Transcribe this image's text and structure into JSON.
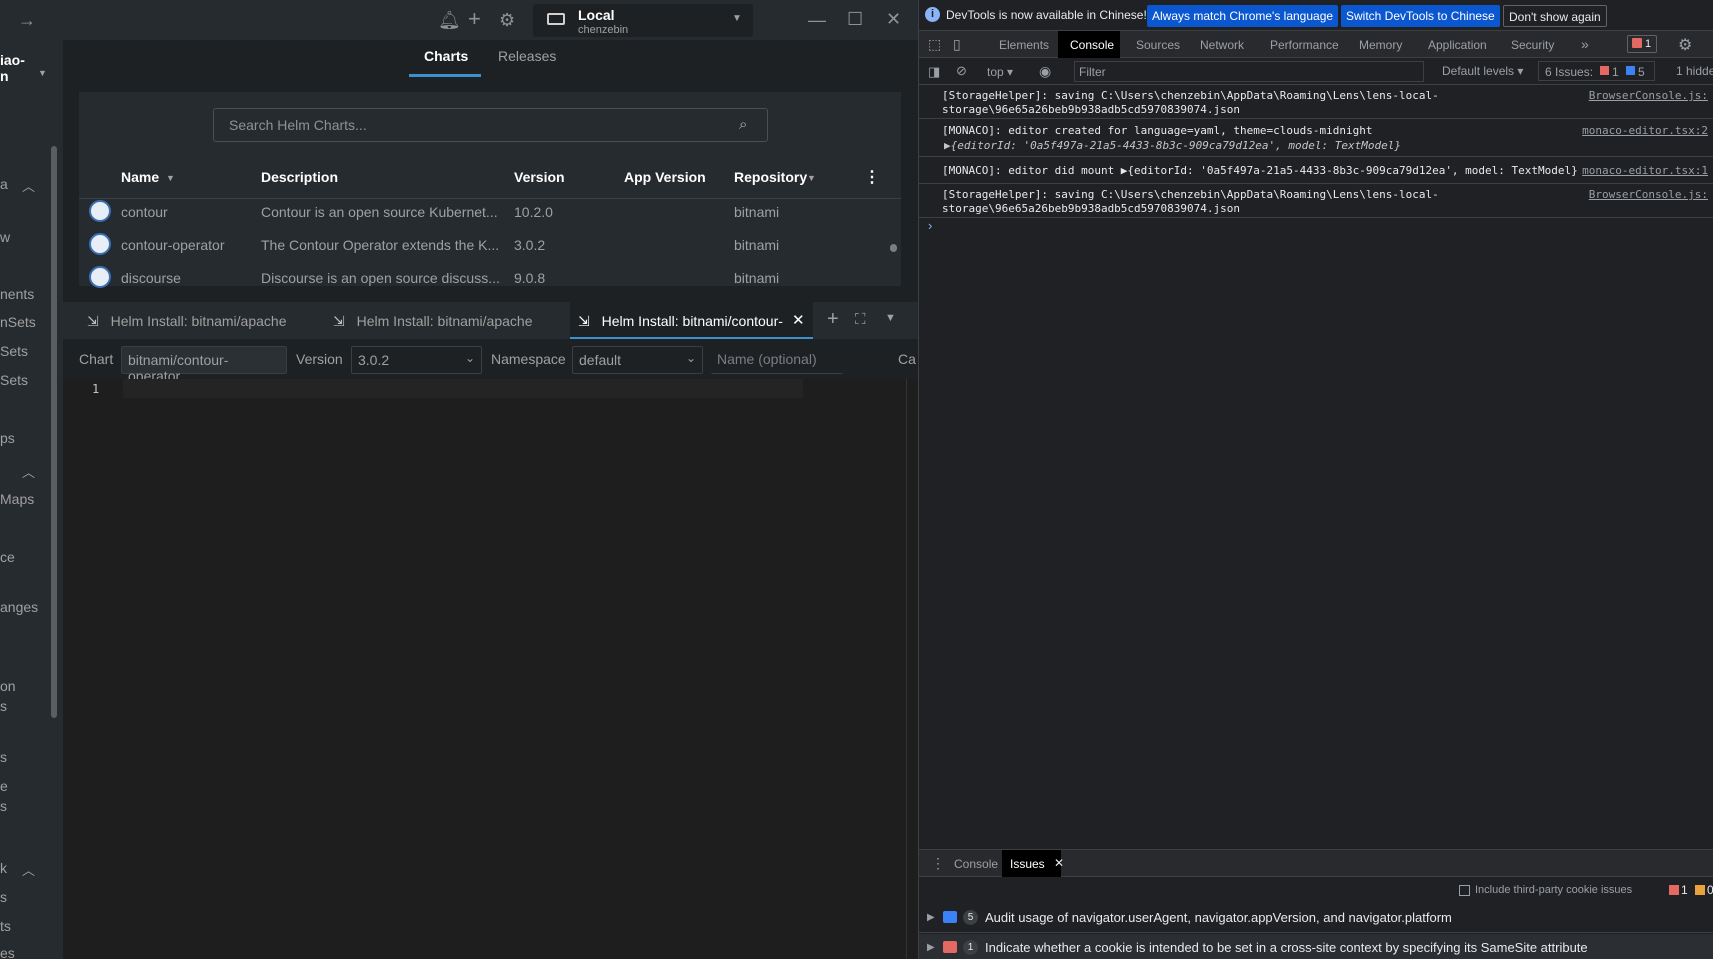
{
  "cluster": {
    "name": "Local",
    "user": "chenzebin"
  },
  "sidebar": {
    "top_label": "iao-\nn",
    "items": [
      "w",
      "nents",
      "nSets",
      "Sets",
      "Sets",
      "ps",
      "Maps",
      "ce",
      "anges",
      "on",
      "s",
      "s",
      "e",
      "s",
      "k",
      "s",
      "ts",
      "es"
    ]
  },
  "tabs": {
    "charts": "Charts",
    "releases": "Releases"
  },
  "search": {
    "placeholder": "Search Helm Charts..."
  },
  "table": {
    "headers": {
      "name": "Name",
      "description": "Description",
      "version": "Version",
      "app_version": "App Version",
      "repository": "Repository"
    },
    "rows": [
      {
        "name": "contour",
        "description": "Contour is an open source Kubernet...",
        "version": "10.2.0",
        "app_version": "",
        "repository": "bitnami"
      },
      {
        "name": "contour-operator",
        "description": "The Contour Operator extends the K...",
        "version": "3.0.2",
        "app_version": "",
        "repository": "bitnami"
      },
      {
        "name": "discourse",
        "description": "Discourse is an open source discuss...",
        "version": "9.0.8",
        "app_version": "",
        "repository": "bitnami"
      }
    ]
  },
  "dock": {
    "tabs": [
      "Helm Install: bitnami/apache",
      "Helm Install: bitnami/apache",
      "Helm Install: bitnami/contour-"
    ]
  },
  "form": {
    "chart_label": "Chart",
    "chart_value": "bitnami/contour-operator",
    "version_label": "Version",
    "version_value": "3.0.2",
    "namespace_label": "Namespace",
    "namespace_value": "default",
    "name_placeholder": "Name (optional)",
    "cancel_label": "Ca"
  },
  "editor": {
    "line": "1"
  },
  "devtools": {
    "info": {
      "message": "DevTools is now available in Chinese!",
      "btn_match": "Always match Chrome's language",
      "btn_switch": "Switch DevTools to Chinese",
      "btn_dismiss": "Don't show again"
    },
    "tabs": [
      "Elements",
      "Console",
      "Sources",
      "Network",
      "Performance",
      "Memory",
      "Application",
      "Security"
    ],
    "error_count": "1",
    "console_toolbar": {
      "context": "top",
      "filter_placeholder": "Filter",
      "levels": "Default levels",
      "issues_label": "6 Issues:",
      "issues_err": "1",
      "issues_info": "5",
      "hidden": "1 hidde"
    },
    "logs": [
      {
        "line1": "[StorageHelper]: saving C:\\Users\\chenzebin\\AppData\\Roaming\\Lens\\lens-local-",
        "line2": "storage\\96e65a26beb9b938adb5cd5970839074.json",
        "source": "BrowserConsole.js:"
      },
      {
        "line1": "[MONACO]: editor created for language=yaml, theme=clouds-midnight",
        "line2": "▶{editorId: '0a5f497a-21a5-4433-8b3c-909ca79d12ea', model: TextModel}",
        "source": "monaco-editor.tsx:2"
      },
      {
        "line1": "[MONACO]: editor did mount ▶{editorId: '0a5f497a-21a5-4433-8b3c-909ca79d12ea', model: TextModel}",
        "line2": "",
        "source": "monaco-editor.tsx:1"
      },
      {
        "line1": "[StorageHelper]: saving C:\\Users\\chenzebin\\AppData\\Roaming\\Lens\\lens-local-",
        "line2": "storage\\96e65a26beb9b938adb5cd5970839074.json",
        "source": "BrowserConsole.js:"
      }
    ],
    "prompt": "›",
    "drawer": {
      "tab_console": "Console",
      "tab_issues": "Issues",
      "third_party": "Include third-party cookie issues",
      "err": "1",
      "warn": "0",
      "issues": [
        {
          "count": "5",
          "text": "Audit usage of navigator.userAgent, navigator.appVersion, and navigator.platform"
        },
        {
          "count": "1",
          "text": "Indicate whether a cookie is intended to be set in a cross-site context by specifying its SameSite attribute"
        }
      ]
    }
  },
  "colors": {
    "accent": "#3d90ce",
    "active_tab_border": "#3d90ce",
    "error": "#e46962",
    "info": "#3b82f6"
  }
}
